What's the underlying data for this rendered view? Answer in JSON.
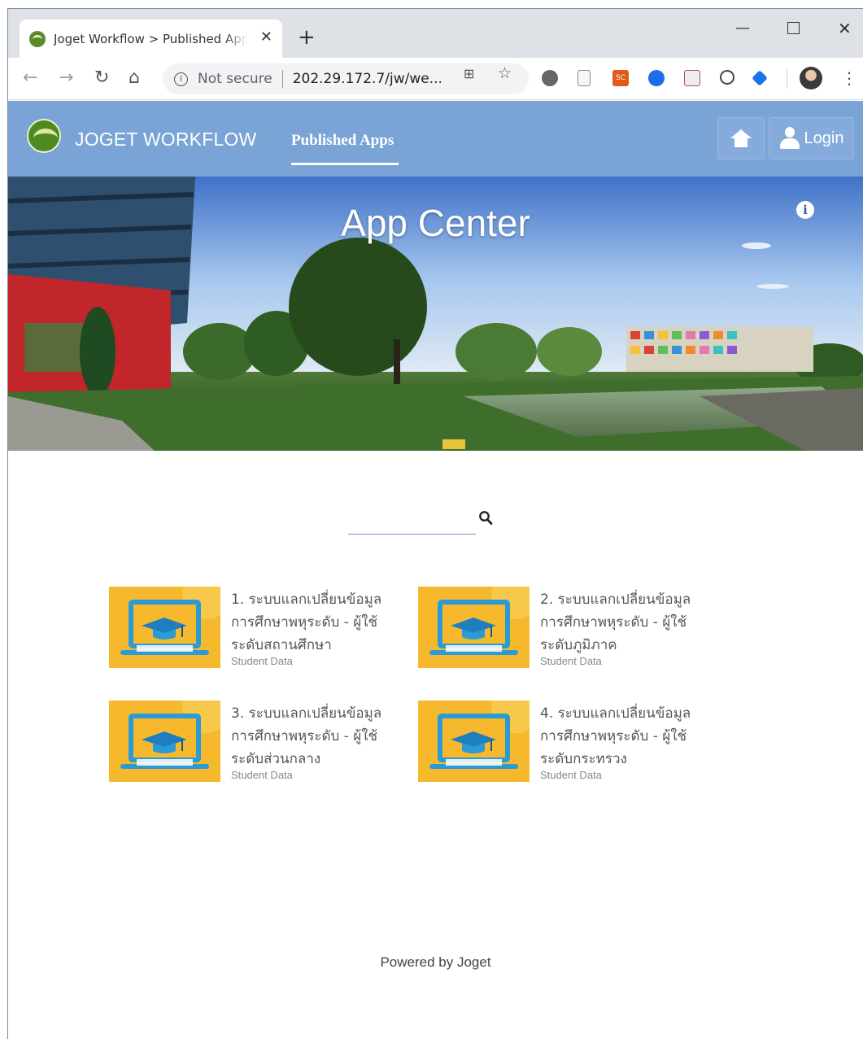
{
  "browser": {
    "tab_title": "Joget Workflow > Published Apps",
    "security_label": "Not secure",
    "url": "202.29.172.7/jw/we..."
  },
  "header": {
    "brand": "JOGET WORKFLOW",
    "nav_published": "Published Apps",
    "login_label": "Login"
  },
  "banner": {
    "title": "App Center"
  },
  "search": {
    "value": ""
  },
  "apps": [
    {
      "name": "1. ระบบแลกเปลี่ยนข้อมูลการศึกษาพหุระดับ - ผู้ใช้ระดับสถานศึกษา",
      "category": "Student Data"
    },
    {
      "name": "2. ระบบแลกเปลี่ยนข้อมูลการศึกษาพหุระดับ - ผู้ใช้ระดับภูมิภาค",
      "category": "Student Data"
    },
    {
      "name": "3. ระบบแลกเปลี่ยนข้อมูลการศึกษาพหุระดับ - ผู้ใช้ระดับส่วนกลาง",
      "category": "Student Data"
    },
    {
      "name": "4. ระบบแลกเปลี่ยนข้อมูลการศึกษาพหุระดับ - ผู้ใช้ระดับกระทรวง",
      "category": "Student Data"
    }
  ],
  "footer": {
    "text": "Powered by Joget"
  },
  "colors": {
    "header_bg": "#7aa3d6",
    "thumb_bg": "#f6b92e",
    "thumb_accent": "#2b9bd6"
  }
}
